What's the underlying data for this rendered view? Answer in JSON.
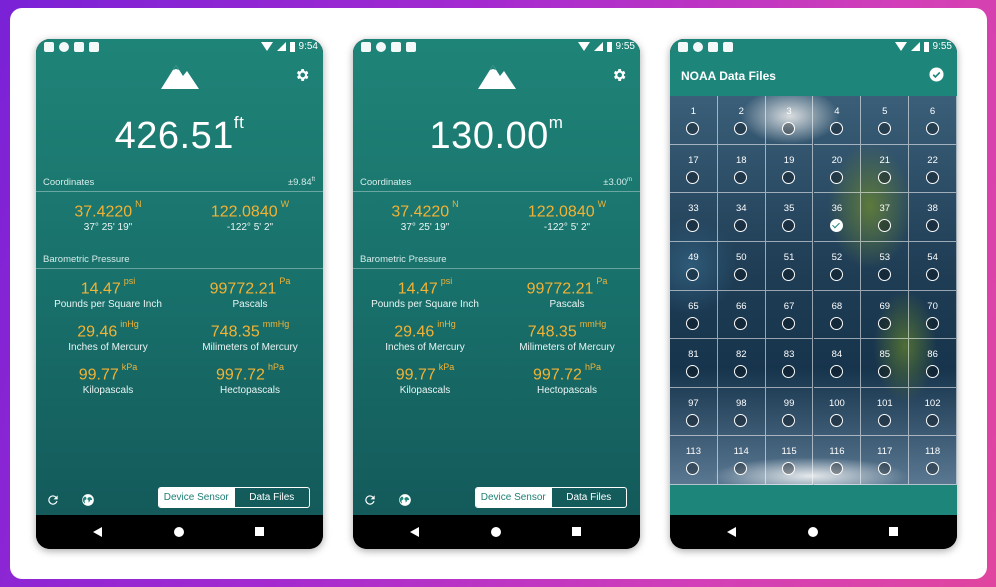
{
  "phones": [
    {
      "status_time": "9:54",
      "altitude_value": "426.51",
      "altitude_unit": "ft",
      "coord_label": "Coordinates",
      "coord_accuracy": "±9.84",
      "coord_accuracy_unit": "ft",
      "lat_value": "37.4220",
      "lat_dir": "N",
      "lat_dms": "37° 25' 19\"",
      "lon_value": "122.0840",
      "lon_dir": "W",
      "lon_dms": "-122° 5' 2\"",
      "baro_label": "Barometric Pressure",
      "p1_value": "14.47",
      "p1_unit": "psi",
      "p1_label": "Pounds per Square Inch",
      "p2_value": "99772.21",
      "p2_unit": "Pa",
      "p2_label": "Pascals",
      "p3_value": "29.46",
      "p3_unit": "inHg",
      "p3_label": "Inches of Mercury",
      "p4_value": "748.35",
      "p4_unit": "mmHg",
      "p4_label": "Milimeters of Mercury",
      "p5_value": "99.77",
      "p5_unit": "kPa",
      "p5_label": "Kilopascals",
      "p6_value": "997.72",
      "p6_unit": "hPa",
      "p6_label": "Hectopascals",
      "toggle_on": "Device Sensor",
      "toggle_off": "Data Files"
    },
    {
      "status_time": "9:55",
      "altitude_value": "130.00",
      "altitude_unit": "m",
      "coord_label": "Coordinates",
      "coord_accuracy": "±3.00",
      "coord_accuracy_unit": "m",
      "lat_value": "37.4220",
      "lat_dir": "N",
      "lat_dms": "37° 25' 19\"",
      "lon_value": "122.0840",
      "lon_dir": "W",
      "lon_dms": "-122° 5' 2\"",
      "baro_label": "Barometric Pressure",
      "p1_value": "14.47",
      "p1_unit": "psi",
      "p1_label": "Pounds per Square Inch",
      "p2_value": "99772.21",
      "p2_unit": "Pa",
      "p2_label": "Pascals",
      "p3_value": "29.46",
      "p3_unit": "inHg",
      "p3_label": "Inches of Mercury",
      "p4_value": "748.35",
      "p4_unit": "mmHg",
      "p4_label": "Milimeters of Mercury",
      "p5_value": "99.77",
      "p5_unit": "kPa",
      "p5_label": "Kilopascals",
      "p6_value": "997.72",
      "p6_unit": "hPa",
      "p6_label": "Hectopascals",
      "toggle_on": "Device Sensor",
      "toggle_off": "Data Files"
    }
  ],
  "files_screen": {
    "status_time": "9:55",
    "title": "NOAA Data Files",
    "tiles": [
      {
        "n": "1"
      },
      {
        "n": "2"
      },
      {
        "n": "3"
      },
      {
        "n": "4"
      },
      {
        "n": "5"
      },
      {
        "n": "6"
      },
      {
        "n": "17"
      },
      {
        "n": "18"
      },
      {
        "n": "19"
      },
      {
        "n": "20"
      },
      {
        "n": "21"
      },
      {
        "n": "22"
      },
      {
        "n": "33"
      },
      {
        "n": "34"
      },
      {
        "n": "35"
      },
      {
        "n": "36",
        "checked": true
      },
      {
        "n": "37"
      },
      {
        "n": "38"
      },
      {
        "n": "49"
      },
      {
        "n": "50"
      },
      {
        "n": "51"
      },
      {
        "n": "52"
      },
      {
        "n": "53"
      },
      {
        "n": "54"
      },
      {
        "n": "65"
      },
      {
        "n": "66"
      },
      {
        "n": "67"
      },
      {
        "n": "68"
      },
      {
        "n": "69"
      },
      {
        "n": "70"
      },
      {
        "n": "81"
      },
      {
        "n": "82"
      },
      {
        "n": "83"
      },
      {
        "n": "84"
      },
      {
        "n": "85"
      },
      {
        "n": "86"
      },
      {
        "n": "97"
      },
      {
        "n": "98"
      },
      {
        "n": "99"
      },
      {
        "n": "100"
      },
      {
        "n": "101"
      },
      {
        "n": "102"
      },
      {
        "n": "113"
      },
      {
        "n": "114"
      },
      {
        "n": "115"
      },
      {
        "n": "116"
      },
      {
        "n": "117"
      },
      {
        "n": "118"
      }
    ]
  },
  "colors": {
    "accent_value": "#f2b234",
    "teal": "#1e857a"
  }
}
